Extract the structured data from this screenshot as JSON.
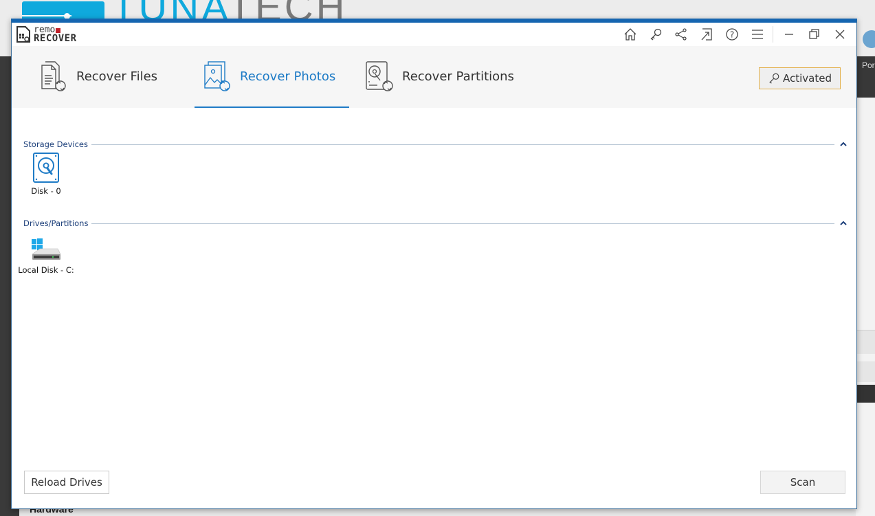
{
  "background": {
    "brand_left": "TUNA",
    "brand_right": "TECH",
    "right_label": "Por",
    "bottom_label": "Hardware"
  },
  "app": {
    "logo_top": "remo",
    "logo_bottom": "RECOVER",
    "titlebar_icons": [
      "home-icon",
      "key-icon",
      "share-icon",
      "external-link-icon",
      "help-icon",
      "menu-icon"
    ],
    "window_controls": [
      "minimize-icon",
      "restore-icon",
      "close-icon"
    ]
  },
  "tabs": [
    {
      "label": "Recover Files",
      "icon": "recover-files-icon",
      "active": false
    },
    {
      "label": "Recover Photos",
      "icon": "recover-photos-icon",
      "active": true
    },
    {
      "label": "Recover Partitions",
      "icon": "recover-partitions-icon",
      "active": false
    }
  ],
  "activation": {
    "label": "Activated",
    "icon": "key-icon"
  },
  "sections": {
    "storage": {
      "title": "Storage Devices",
      "devices": [
        {
          "label": "Disk - 0",
          "icon": "hard-disk-icon"
        }
      ]
    },
    "drives": {
      "title": "Drives/Partitions",
      "devices": [
        {
          "label": "Local Disk - C:",
          "icon": "windows-drive-icon"
        }
      ]
    }
  },
  "footer": {
    "reload_label": "Reload Drives",
    "scan_label": "Scan"
  },
  "colors": {
    "accent": "#1e7bc6",
    "titlebar_border": "#1565b0",
    "activated_border": "#e3b04a",
    "section_title": "#1c3f7a"
  }
}
